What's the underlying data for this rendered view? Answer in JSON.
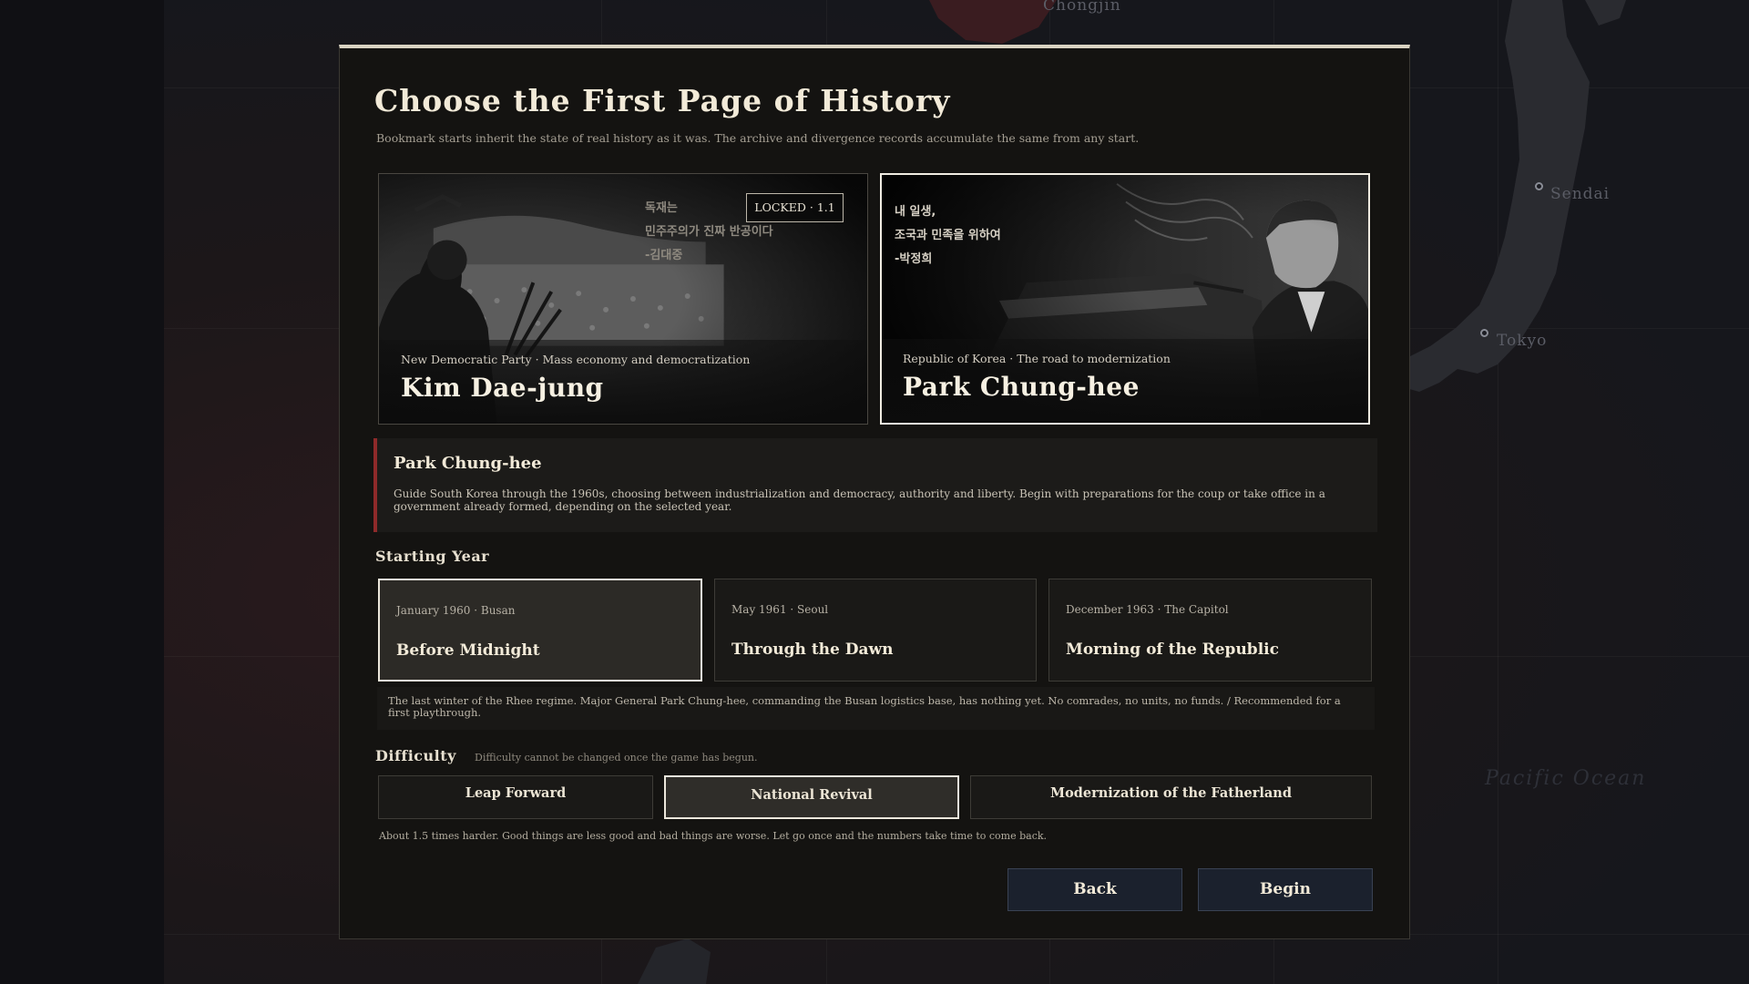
{
  "map": {
    "labels": {
      "chongjin": "Chongjin",
      "sendai": "Sendai",
      "tokyo": "Tokyo",
      "ocean": "Pacific Ocean"
    }
  },
  "modal": {
    "title": "Choose the First Page of History",
    "subtitle": "Bookmark starts inherit the state of real history as it was. The archive and divergence records accumulate the same from any start."
  },
  "leaders": [
    {
      "meta": "New Democratic Party · Mass economy and democratization",
      "name": "Kim Dae-jung",
      "quote": "독재는\n민주주의가 진짜 반공이다\n-김대중",
      "badge": "LOCKED · 1.1",
      "selected": false
    },
    {
      "meta": "Republic of Korea · The road to modernization",
      "name": "Park Chung-hee",
      "quote": "내 일생,\n조국과 민족을 위하여\n-박정희",
      "selected": true
    }
  ],
  "description": {
    "title": "Park Chung-hee",
    "body": "Guide South Korea through the 1960s, choosing between industrialization and democracy, authority and liberty. Begin with preparations for the coup or take office in a government already formed, depending on the selected year."
  },
  "starting_year": {
    "label": "Starting Year",
    "options": [
      {
        "meta": "January 1960 · Busan",
        "title": "Before Midnight",
        "selected": true
      },
      {
        "meta": "May 1961 · Seoul",
        "title": "Through the Dawn",
        "selected": false
      },
      {
        "meta": "December 1963 · The Capitol",
        "title": "Morning of the Republic",
        "selected": false
      }
    ],
    "description": "The last winter of the Rhee regime. Major General Park Chung-hee, commanding the Busan logistics base, has nothing yet. No comrades, no units, no funds. / Recommended for a first playthrough."
  },
  "difficulty": {
    "label": "Difficulty",
    "hint": "Difficulty cannot be changed once the game has begun.",
    "options": [
      {
        "label": "Leap Forward",
        "selected": false
      },
      {
        "label": "National Revival",
        "selected": true
      },
      {
        "label": "Modernization of the Fatherland",
        "selected": false
      }
    ],
    "description": "About 1.5 times harder. Good things are less good and bad things are worse. Let go once and the numbers take time to come back."
  },
  "actions": {
    "back": "Back",
    "begin": "Begin"
  },
  "colors": {
    "accent_red": "#8e2a2a",
    "modal_bg": "#141311",
    "button_bg": "#1b212d",
    "text_primary": "#f2ead8"
  }
}
